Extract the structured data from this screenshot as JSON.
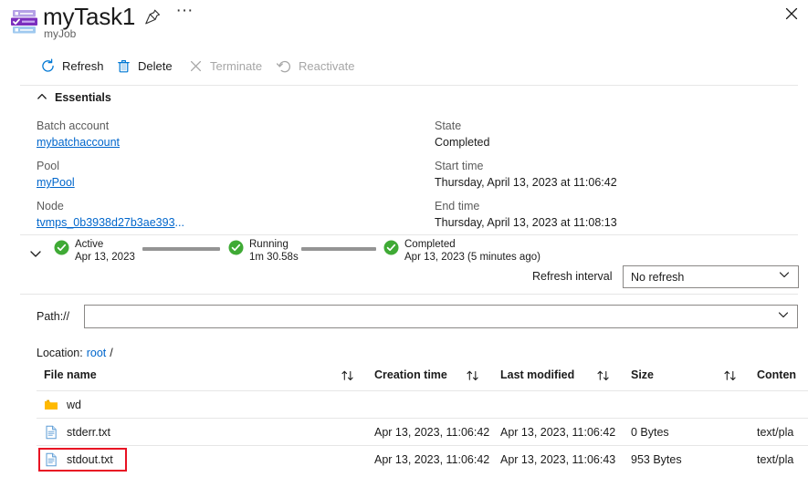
{
  "header": {
    "title": "myTask1",
    "subtitle": "myJob",
    "task_icon": "task-icon",
    "pin_icon": "pin-icon",
    "more_icon": "ellipsis-icon",
    "close_icon": "close-icon"
  },
  "toolbar": {
    "refresh_label": "Refresh",
    "delete_label": "Delete",
    "terminate_label": "Terminate",
    "reactivate_label": "Reactivate"
  },
  "essentials": {
    "section_label": "Essentials",
    "left": [
      {
        "label": "Batch account",
        "value": "mybatchaccount",
        "is_link": true
      },
      {
        "label": "Pool",
        "value": "myPool",
        "is_link": true
      },
      {
        "label": "Node",
        "value": "tvmps_0b3938d27b3ae393",
        "suffix": "...",
        "is_link": true
      }
    ],
    "right": [
      {
        "label": "State",
        "value": "Completed"
      },
      {
        "label": "Start time",
        "value": "Thursday, April 13, 2023 at 11:06:42"
      },
      {
        "label": "End time",
        "value": "Thursday, April 13, 2023 at 11:08:13"
      }
    ]
  },
  "timeline": {
    "stages": [
      {
        "name": "Active",
        "detail": "Apr 13, 2023"
      },
      {
        "name": "Running",
        "detail": "1m 30.58s"
      },
      {
        "name": "Completed",
        "detail": "Apr 13, 2023 (5 minutes ago)"
      }
    ],
    "chevron_icon": "chevron-down-icon",
    "check_icon": "check-circle-icon",
    "check_color": "#3faa35",
    "connector_color": "#949494"
  },
  "refresh_interval": {
    "label": "Refresh interval",
    "value": "No refresh"
  },
  "path_bar": {
    "label": "Path://",
    "value": "",
    "placeholder": ""
  },
  "location": {
    "label": "Location:",
    "link": "root",
    "separator": "/"
  },
  "file_table": {
    "columns": [
      {
        "label": "File name",
        "sortable": true
      },
      {
        "label": "Creation time",
        "sortable": true
      },
      {
        "label": "Last modified",
        "sortable": true
      },
      {
        "label": "Size",
        "sortable": true
      },
      {
        "label": "Conten",
        "sortable": false
      }
    ],
    "rows": [
      {
        "icon": "folder-icon",
        "name": "wd",
        "creation_time": "",
        "last_modified": "",
        "size": "",
        "content_type": "",
        "highlighted": false
      },
      {
        "icon": "file-icon",
        "name": "stderr.txt",
        "creation_time": "Apr 13, 2023, 11:06:42",
        "last_modified": "Apr 13, 2023, 11:06:42",
        "size": "0 Bytes",
        "content_type": "text/pla",
        "highlighted": false
      },
      {
        "icon": "file-icon",
        "name": "stdout.txt",
        "creation_time": "Apr 13, 2023, 11:06:42",
        "last_modified": "Apr 13, 2023, 11:06:43",
        "size": "953 Bytes",
        "content_type": "text/pla",
        "highlighted": true
      }
    ]
  },
  "colors": {
    "link": "#0066cc",
    "accent": "#0078d4",
    "highlight": "#e81123",
    "success": "#3faa35",
    "disabled_text": "#a6a6a6",
    "folder": "#ffb900"
  }
}
